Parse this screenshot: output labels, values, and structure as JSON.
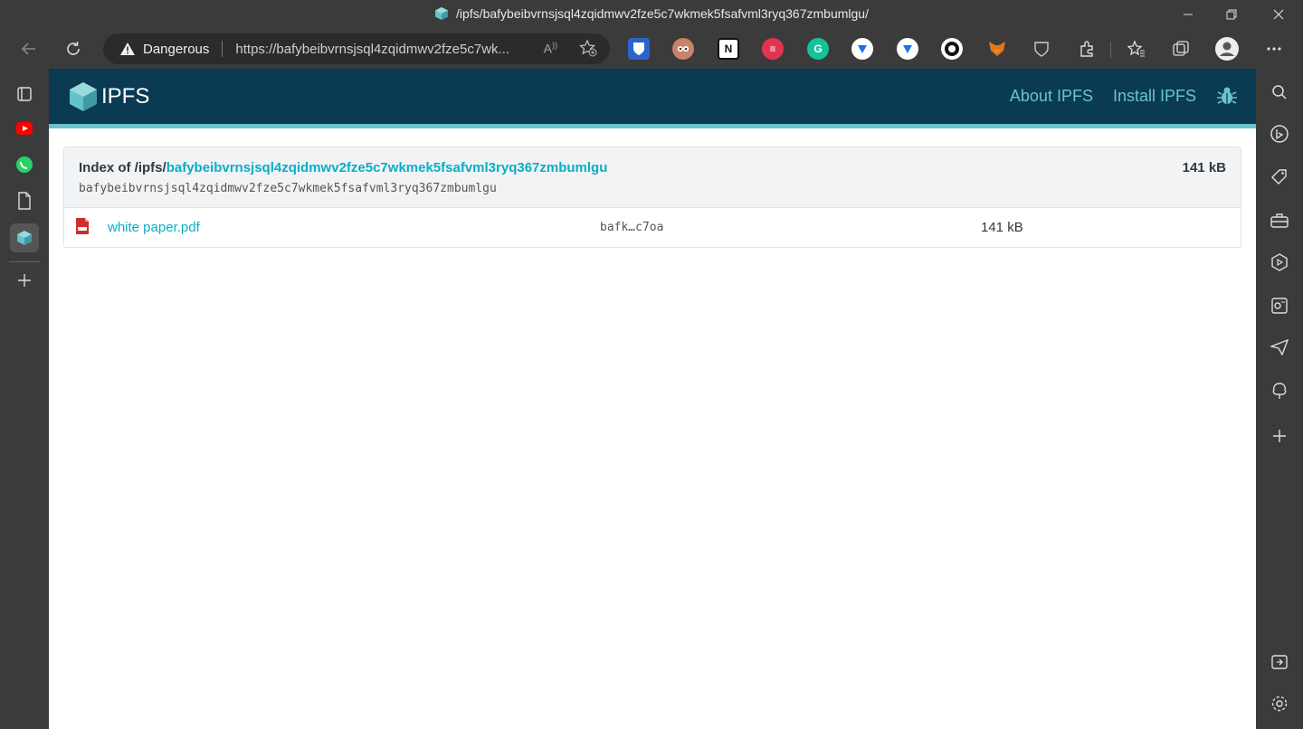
{
  "window": {
    "title": "/ipfs/bafybeibvrnsjsql4zqidmwv2fze5c7wkmek5fsafvml3ryq367zmbumlgu/"
  },
  "address_bar": {
    "security_label": "Dangerous",
    "url": "https://bafybeibvrnsjsql4zqidmwv2fze5c7wk..."
  },
  "colors": {
    "ipfs_header": "#0b3a53",
    "ipfs_accent": "#69c4cd",
    "link": "#0aaec4"
  },
  "ipfs": {
    "logo_text": "IPFS",
    "nav": {
      "about": "About IPFS",
      "install": "Install IPFS"
    }
  },
  "listing": {
    "index_prefix": "Index of /ipfs/",
    "index_hash": "bafybeibvrnsjsql4zqidmwv2fze5c7wkmek5fsafvml3ryq367zmbumlgu",
    "cid": "bafybeibvrnsjsql4zqidmwv2fze5c7wkmek5fsafvml3ryq367zmbumlgu",
    "total_size": "141 kB",
    "files": [
      {
        "name": "white paper.pdf",
        "cid": "bafk…c7oa",
        "size": "141 kB",
        "icon": "pdf-icon"
      }
    ]
  }
}
